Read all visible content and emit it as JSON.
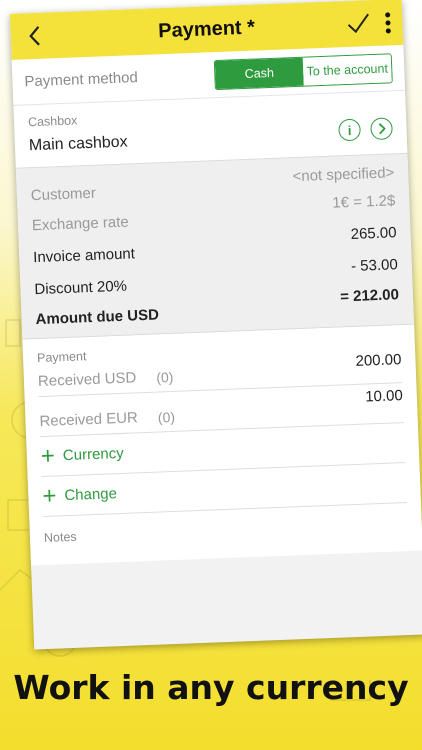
{
  "header": {
    "title": "Payment *",
    "back_icon": "chevron-left-icon",
    "confirm_icon": "checkmark-icon",
    "menu_icon": "more-vertical-icon"
  },
  "payment_method": {
    "label": "Payment method",
    "options": [
      "Cash",
      "To the account"
    ],
    "selected": "Cash"
  },
  "cashbox": {
    "label": "Cashbox",
    "value": "Main cashbox"
  },
  "details": {
    "customer_label": "Customer",
    "customer_value": "<not specified>",
    "rate_label": "Exchange rate",
    "rate_value": "1€ = 1.2$",
    "invoice_label": "Invoice amount",
    "invoice_value": "265.00",
    "discount_label": "Discount 20%",
    "discount_value": "- 53.00",
    "due_label": "Amount due USD",
    "due_value": "= 212.00"
  },
  "payment": {
    "label": "Payment",
    "received_usd_label": "Received USD",
    "received_usd_count": "(0)",
    "received_usd_value": "200.00",
    "received_eur_label": "Received EUR",
    "received_eur_count": "(0)",
    "received_eur_value": "10.00",
    "add_currency": "Currency",
    "add_change": "Change",
    "notes_label": "Notes"
  },
  "caption": "Work in any currency",
  "colors": {
    "accent": "#2e9b3e",
    "topbar": "#f4e23a",
    "background_yellow": "#f3de2c"
  }
}
